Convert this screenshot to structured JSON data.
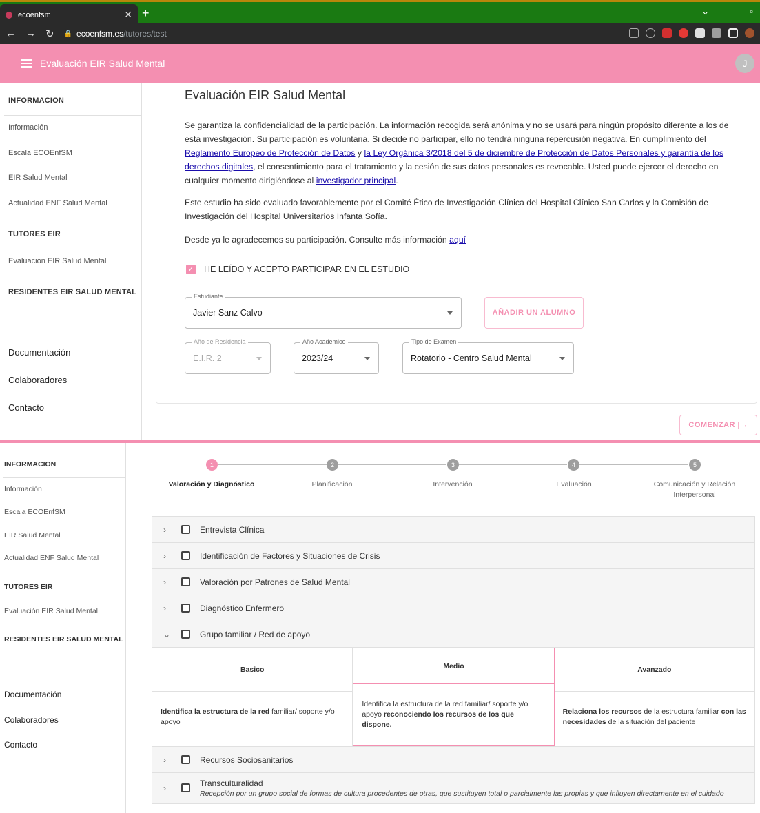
{
  "browser": {
    "tab_title": "ecoenfsm",
    "url_host": "ecoenfsm.es",
    "url_path": "/tutores/test"
  },
  "appbar": {
    "title": "Evaluación EIR Salud Mental",
    "avatar_initial": "J"
  },
  "sidebar": {
    "section1": "INFORMACION",
    "info_items": [
      "Información",
      "Escala ECOEnfSM",
      "EIR Salud Mental",
      "Actualidad ENF Salud Mental"
    ],
    "section2": "TUTORES EIR",
    "tutor_items": [
      "Evaluación EIR Salud Mental"
    ],
    "section3": "RESIDENTES EIR SALUD MENTAL",
    "bottom_items": [
      "Documentación",
      "Colaboradores",
      "Contacto"
    ]
  },
  "main": {
    "title": "Evaluación EIR Salud Mental",
    "p1_a": "Se garantiza la confidencialidad de la participación. La información recogida será anónima y no se usará para ningún propósito diferente a los de esta investigación. Su participación es voluntaria. Si decide no participar, ello no tendrá ninguna repercusión negativa. En cumplimiento del ",
    "p1_link1": "Reglamento Europeo de Protección de Datos",
    "p1_b": " y ",
    "p1_link2": "la Ley Orgánica 3/2018 del 5 de diciembre de Protección de Datos Personales y garantía de los derechos digitales",
    "p1_c": ", el consentimiento para el tratamiento y la cesión de sus datos personales es revocable. Usted puede ejercer el derecho en cualquier momento dirigiéndose al ",
    "p1_link3": "investigador principal",
    "p1_d": ".",
    "p2": "Este estudio ha sido evaluado favorablemente por el Comité Ético de Investigación Clínica del Hospital Clínico San Carlos y la Comisión de Investigación del Hospital Universitarios Infanta Sofía.",
    "p3": "Desde ya le agradecemos su participación. Consulte más información ",
    "p3_link": "aquí",
    "consent_label": "HE LEÍDO Y ACEPTO PARTICIPAR EN EL ESTUDIO",
    "consent_checked": true,
    "student": {
      "label": "Estudiante",
      "value": "Javier Sanz Calvo"
    },
    "add_student_button": "AÑADIR UN ALUMNO",
    "year_residence": {
      "label": "Año de Residencia",
      "value": "E.I.R. 2"
    },
    "academic_year": {
      "label": "Año Academico",
      "value": "2023/24"
    },
    "exam_type": {
      "label": "Tipo de Examen",
      "value": "Rotatorio - Centro Salud Mental"
    },
    "start_button": "COMENZAR |→"
  },
  "stepper": {
    "active": 1,
    "steps": [
      {
        "n": "1",
        "label": "Valoración y Diagnóstico"
      },
      {
        "n": "2",
        "label": "Planificación"
      },
      {
        "n": "3",
        "label": "Intervención"
      },
      {
        "n": "4",
        "label": "Evaluación"
      },
      {
        "n": "5",
        "label": "Comunicación y Relación Interpersonal"
      }
    ]
  },
  "accordion": {
    "items": [
      {
        "label": "Entrevista Clínica",
        "expanded": false
      },
      {
        "label": "Identificación de Factores y Situaciones de Crisis",
        "expanded": false
      },
      {
        "label": "Valoración por Patrones de Salud Mental",
        "expanded": false
      },
      {
        "label": "Diagnóstico Enfermero",
        "expanded": false
      },
      {
        "label": "Grupo familiar / Red de apoyo",
        "expanded": true
      },
      {
        "label": "Recursos Sociosanitarios",
        "expanded": false
      },
      {
        "label": "Transculturalidad",
        "expanded": false,
        "description": "Recepción por un grupo social de formas de cultura procedentes de otras, que sustituyen total o parcialmente las propias y que influyen directamente en el cuidado"
      }
    ],
    "levels": {
      "basico": {
        "title": "Basico",
        "bold1": "Identifica la estructura de la red",
        "text1": " familiar/ soporte y/o apoyo"
      },
      "medio": {
        "title": "Medio",
        "text1": "Identifica la estructura de la red familiar/ soporte y/o apoyo ",
        "bold1": "reconociendo los recursos de los que dispone."
      },
      "avanzado": {
        "title": "Avanzado",
        "bold1": "Relaciona los recursos",
        "text1": " de la estructura familiar ",
        "bold2": "con las necesidades",
        "text2": " de la situación del paciente"
      }
    }
  },
  "colors": {
    "accent": "#f48fb1",
    "tabbar": "#1a7a12"
  }
}
